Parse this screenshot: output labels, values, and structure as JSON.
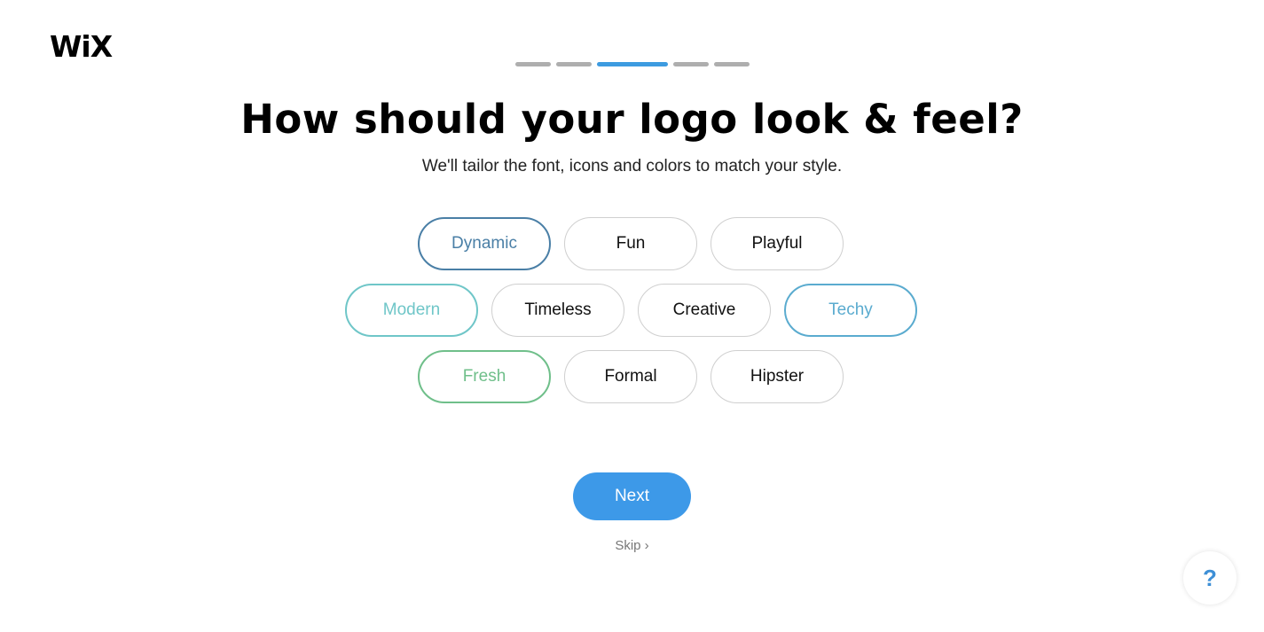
{
  "brand": {
    "logo_text": "WiX"
  },
  "progress": {
    "total_steps": 5,
    "current_step": 3,
    "active_color": "#3d9be0",
    "inactive_color": "#aeaeae"
  },
  "header": {
    "title": "How should your logo look & feel?",
    "subtitle": "We'll tailor the font, icons and colors to match your style."
  },
  "styles": [
    {
      "label": "Dynamic",
      "selected": true,
      "color": "#4a7fa6"
    },
    {
      "label": "Fun",
      "selected": false,
      "color": "#111111"
    },
    {
      "label": "Playful",
      "selected": false,
      "color": "#111111"
    },
    {
      "label": "Modern",
      "selected": true,
      "color": "#6fc6c8"
    },
    {
      "label": "Timeless",
      "selected": false,
      "color": "#111111"
    },
    {
      "label": "Creative",
      "selected": false,
      "color": "#111111"
    },
    {
      "label": "Techy",
      "selected": true,
      "color": "#5aabcf"
    },
    {
      "label": "Fresh",
      "selected": true,
      "color": "#6fbf8a"
    },
    {
      "label": "Formal",
      "selected": false,
      "color": "#111111"
    },
    {
      "label": "Hipster",
      "selected": false,
      "color": "#111111"
    }
  ],
  "actions": {
    "next_label": "Next",
    "skip_label": "Skip",
    "skip_icon": "chevron-right-icon",
    "skip_glyph": "›"
  },
  "help": {
    "icon": "question-icon",
    "glyph": "?"
  }
}
